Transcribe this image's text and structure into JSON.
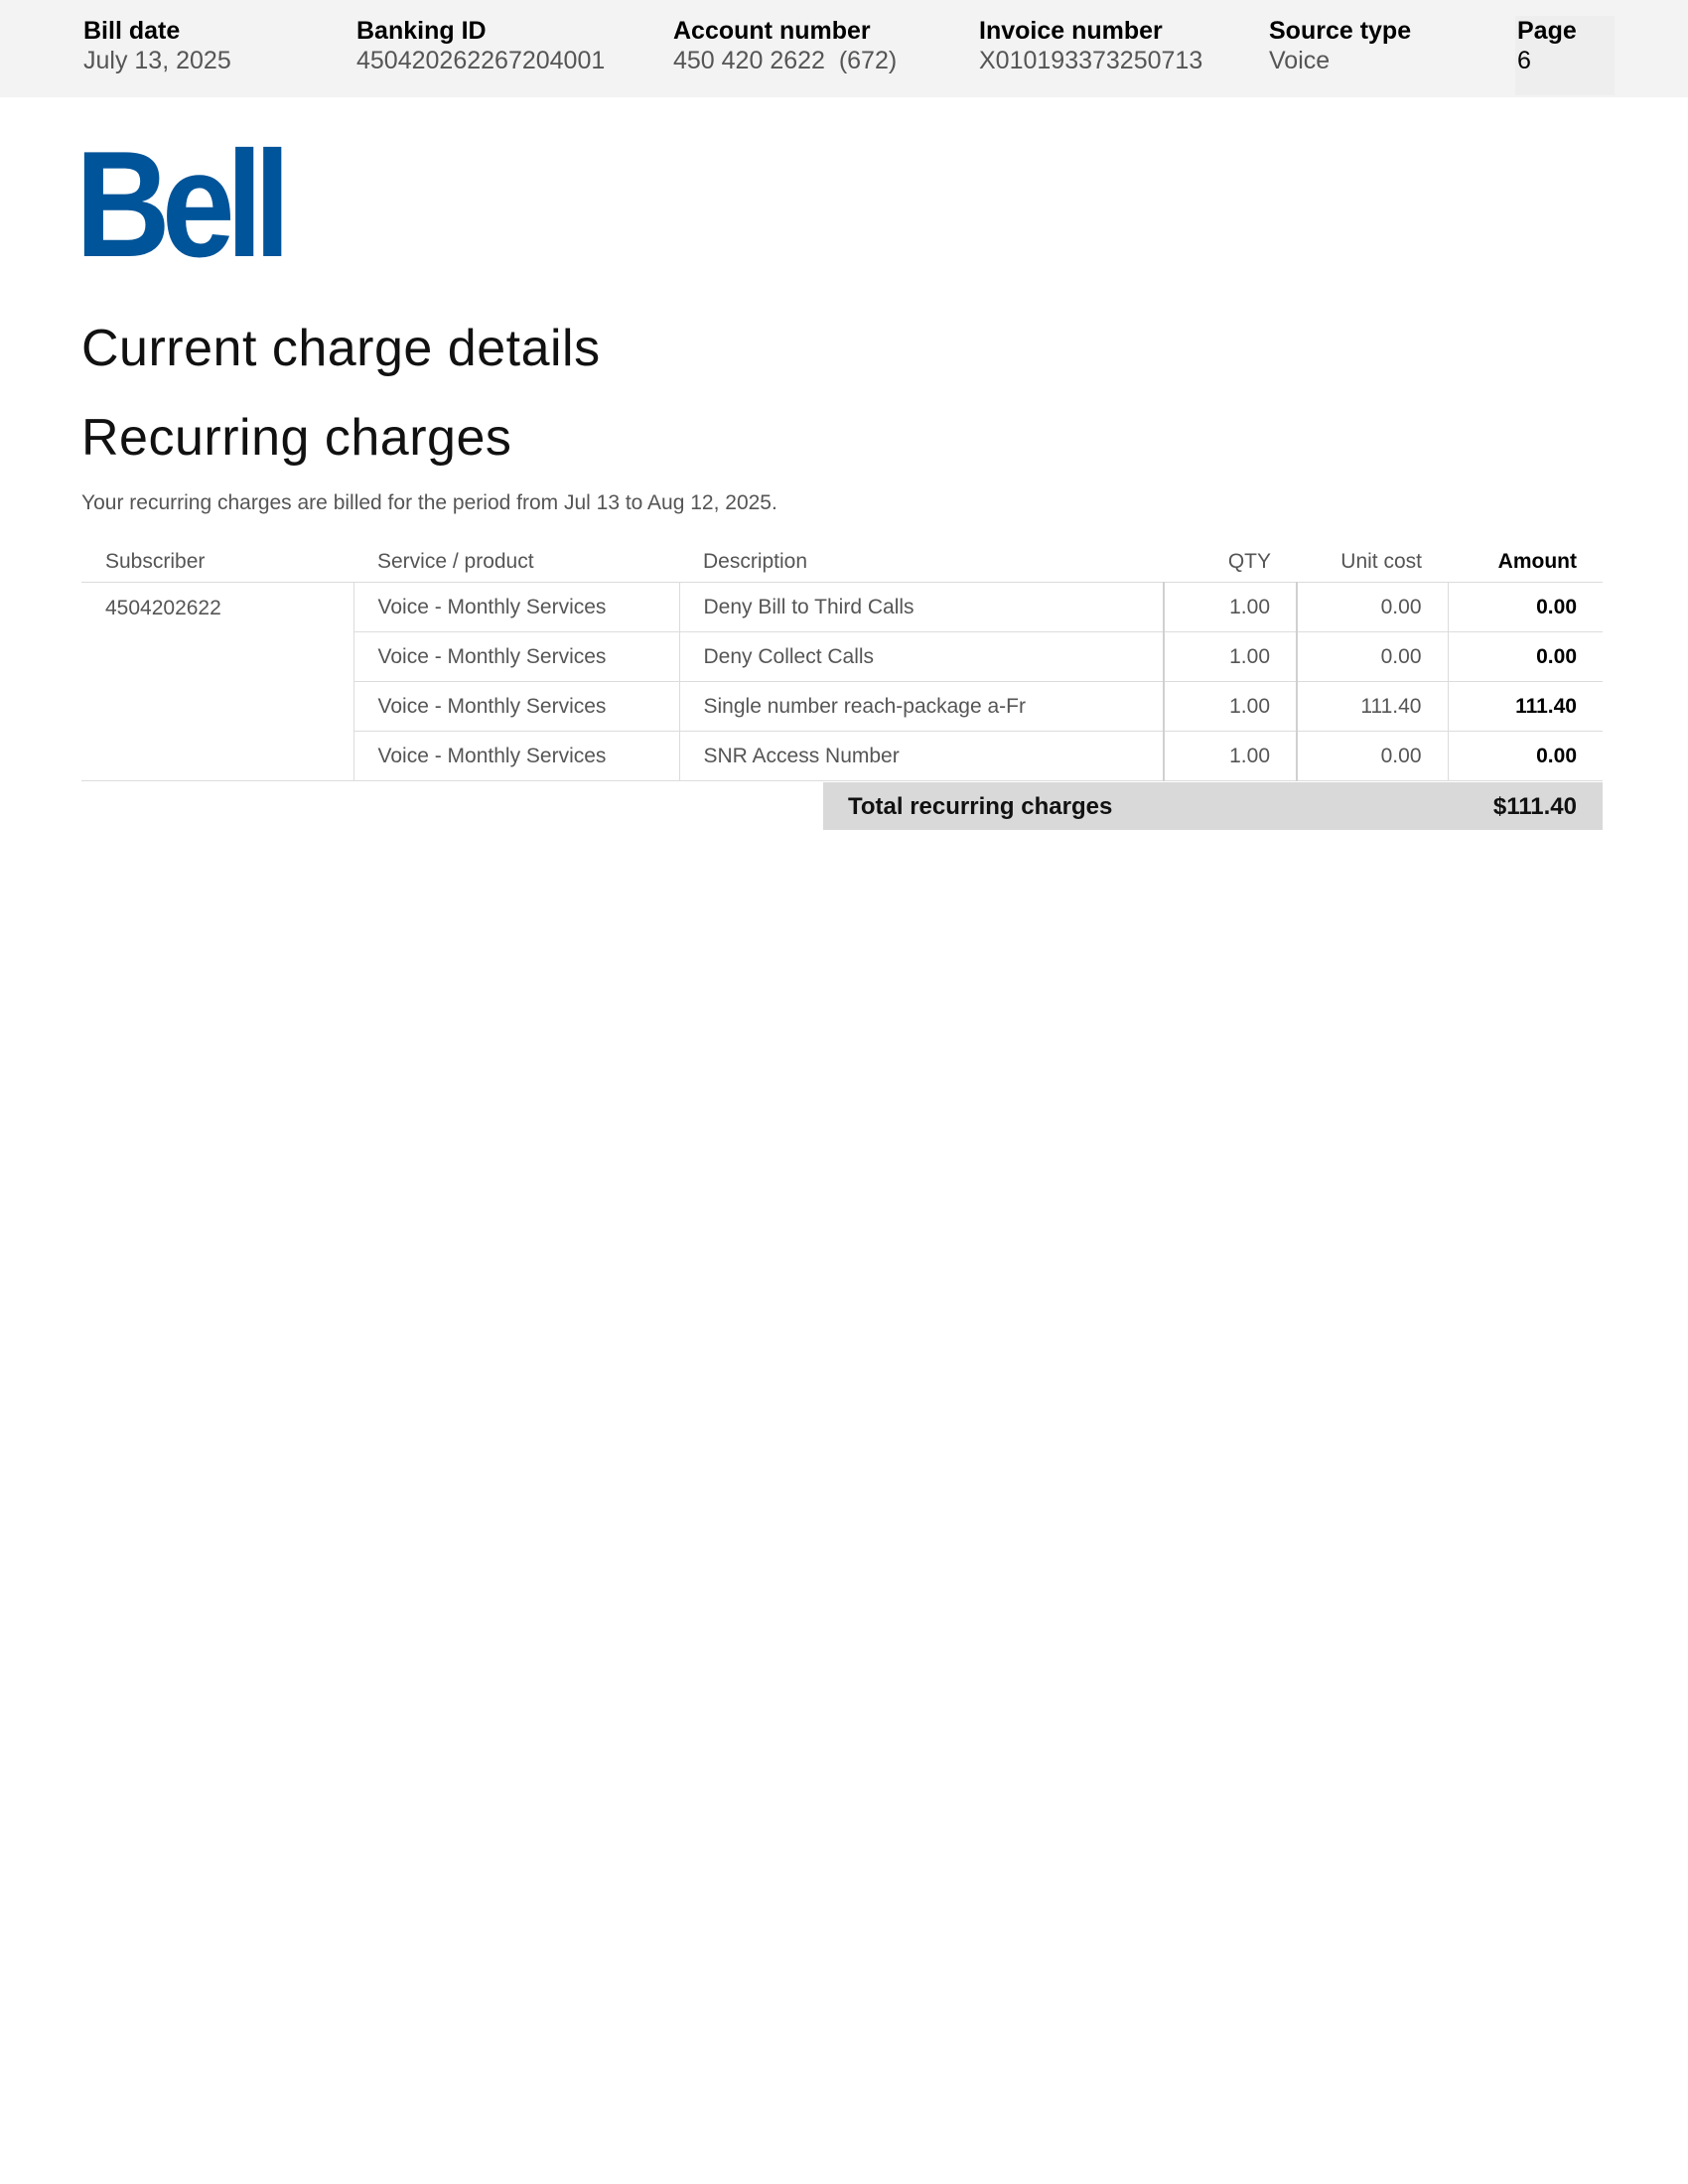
{
  "header": {
    "bill_date": {
      "label": "Bill date",
      "value": "July 13, 2025"
    },
    "banking_id": {
      "label": "Banking ID",
      "value": "450420262267204001"
    },
    "account_number": {
      "label": "Account number",
      "value": "450 420 2622  (672)"
    },
    "invoice_number": {
      "label": "Invoice number",
      "value": "X010193373250713"
    },
    "source_type": {
      "label": "Source type",
      "value": "Voice"
    },
    "page": {
      "label": "Page",
      "value": "6"
    }
  },
  "brand": {
    "logo_text": "Bell",
    "color": "#00549a"
  },
  "main": {
    "title": "Current charge details",
    "section_title": "Recurring charges",
    "period_note": "Your recurring charges are billed for the period from Jul 13 to Aug 12, 2025."
  },
  "table": {
    "columns": {
      "subscriber": "Subscriber",
      "service": "Service / product",
      "description": "Description",
      "qty": "QTY",
      "unit_cost": "Unit cost",
      "amount": "Amount"
    },
    "subscriber": "4504202622",
    "rows": [
      {
        "service": "Voice - Monthly Services",
        "description": "Deny Bill to Third Calls",
        "qty": "1.00",
        "unit_cost": "0.00",
        "amount": "0.00"
      },
      {
        "service": "Voice - Monthly Services",
        "description": "Deny Collect Calls",
        "qty": "1.00",
        "unit_cost": "0.00",
        "amount": "0.00"
      },
      {
        "service": "Voice - Monthly Services",
        "description": "Single number reach-package a-Fr",
        "qty": "1.00",
        "unit_cost": "111.40",
        "amount": "111.40"
      },
      {
        "service": "Voice - Monthly Services",
        "description": "SNR Access Number",
        "qty": "1.00",
        "unit_cost": "0.00",
        "amount": "0.00"
      }
    ],
    "total_label": "Total recurring charges",
    "total_value": "$111.40"
  }
}
